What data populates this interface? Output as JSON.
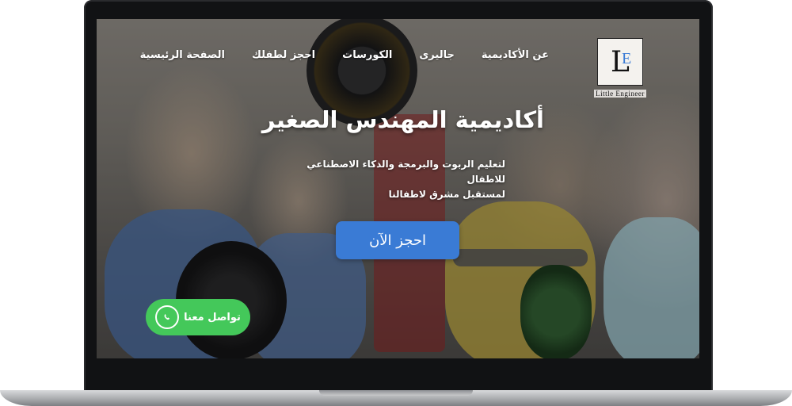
{
  "logo": {
    "letter": "L",
    "accent_letter": "E",
    "text": "Little Engineer"
  },
  "nav": {
    "items": [
      {
        "label": "الصفحة  الرئيسية"
      },
      {
        "label": "احجز لطفلك"
      },
      {
        "label": "الكورسات"
      },
      {
        "label": "جاليرى"
      },
      {
        "label": "عن الأكاديمية"
      }
    ]
  },
  "hero": {
    "title": "أكاديمية المهندس الصغير",
    "subtitle_line1": "لتعليم الربوت والبرمجة والذكاء الاصطناعي للاطفال",
    "subtitle_line2": "لمستقبل مشرق لاطفالنا",
    "cta_label": "احجز الآن"
  },
  "whatsapp": {
    "label": "تواصل معنا"
  },
  "colors": {
    "accent": "#3a7bd5",
    "whatsapp": "#44c85a"
  },
  "icons": {
    "whatsapp": "whatsapp-icon"
  }
}
